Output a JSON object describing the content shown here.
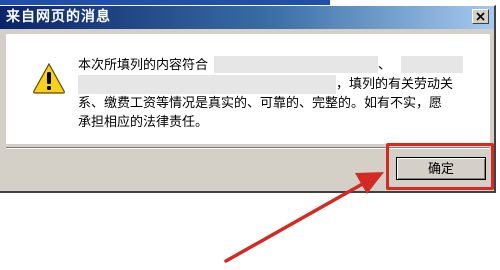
{
  "dialog": {
    "title": "来自网页的消息",
    "message_line_1": "本次所填列的内容符合",
    "message_line_1_tail": "、",
    "message_line_2": "，填列的有关劳动关",
    "message_line_3": "系、缴费工资等情况是真实的、可靠的、完整的。如有不实，愿",
    "message_line_4": "承担相应的法律责任。",
    "ok_label": "确定"
  },
  "icons": {
    "warning": "warning-icon",
    "close": "close-icon",
    "arrow": "red-arrow-annotation"
  },
  "colors": {
    "title_bar_start": "#0a246a",
    "title_bar_end": "#a6caf0",
    "dialog_face": "#d4d0c8",
    "highlight": "#d42a24",
    "warning_yellow": "#f7d21c"
  }
}
